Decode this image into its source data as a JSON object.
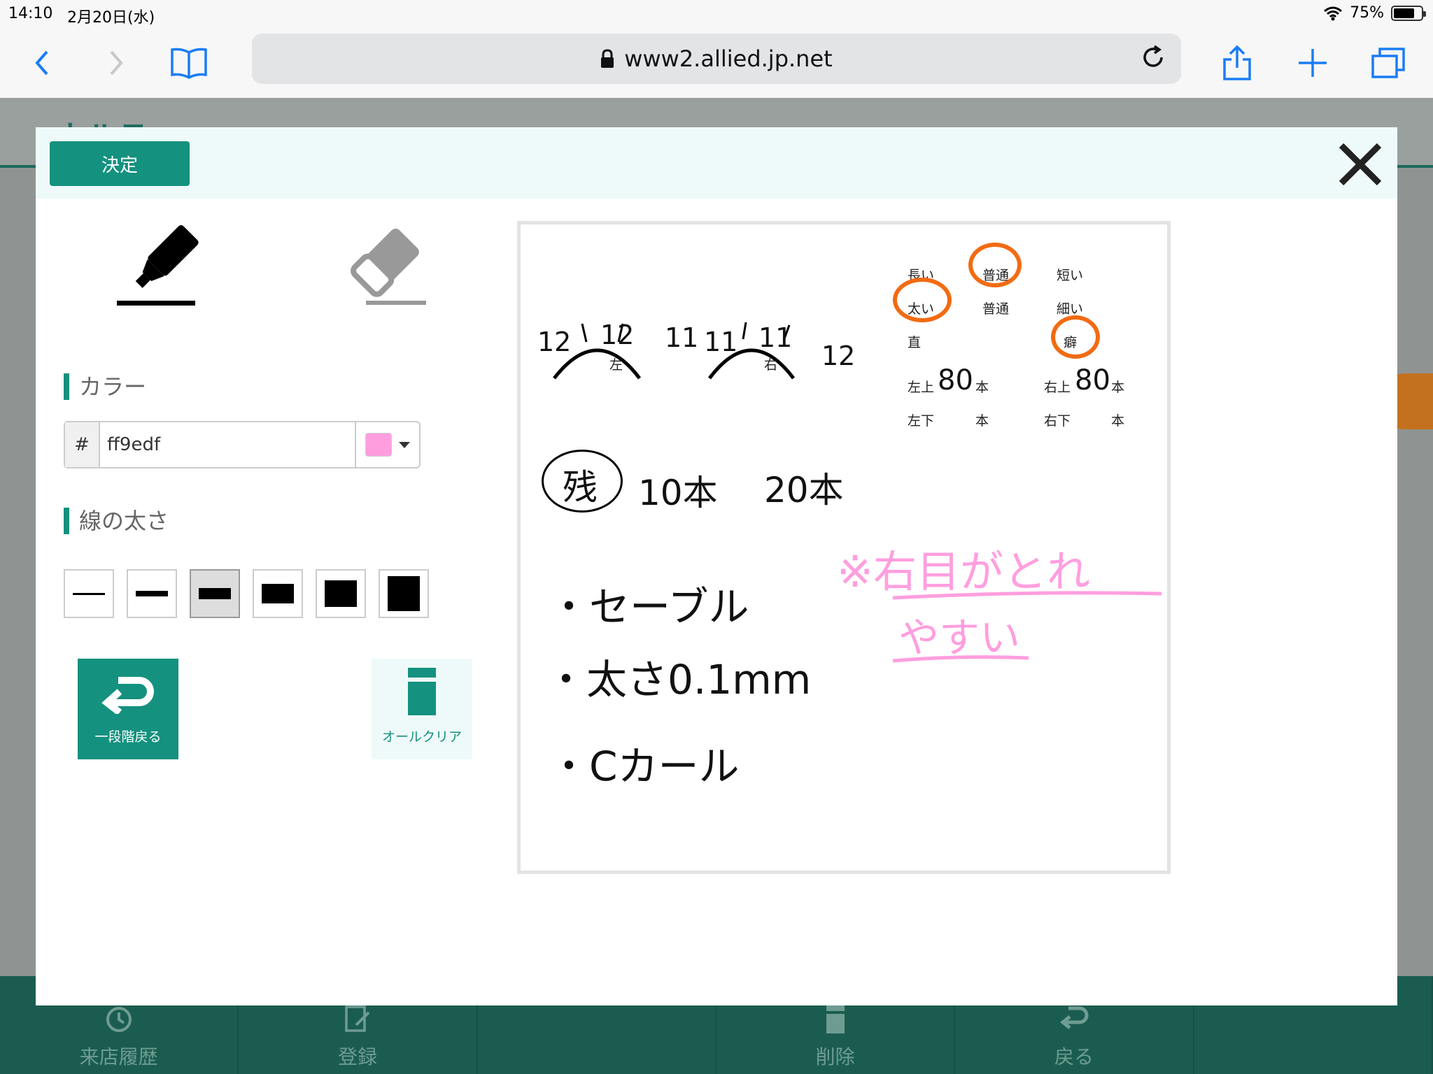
{
  "status": {
    "time": "14:10",
    "date": "2月20日(水)",
    "battery": "75%",
    "battery_level": 0.75
  },
  "browser": {
    "url": "www2.allied.jp.net"
  },
  "underlying": {
    "title": "カルテ",
    "bottom_tabs": [
      "来店履歴",
      "登録",
      "",
      "削除",
      "戻る",
      ""
    ]
  },
  "modal": {
    "decide_label": "決定",
    "color_label": "カラー",
    "color_hash": "#",
    "color_value": "ff9edf",
    "swatch_color": "#ff9edf",
    "width_label": "線の太さ",
    "undo_label": "一段階戻る",
    "clear_label": "オールクリア"
  },
  "canvas": {
    "labels": {
      "long": "長い",
      "normal1": "普通",
      "short": "短い",
      "thick": "太い",
      "normal2": "普通",
      "thin": "細い",
      "straight": "直",
      "habit": "癖",
      "upper_left": "左上",
      "upper_right": "右上",
      "lower_left": "左下",
      "lower_right": "右下",
      "hon": "本",
      "left_eye": "左",
      "right_eye": "右"
    },
    "handwriting": {
      "counts_left": [
        "12",
        "12",
        "11"
      ],
      "counts_right": [
        "11",
        "11",
        "12"
      ],
      "upper_left_count": "80",
      "upper_right_count": "80",
      "zan": "残",
      "zan_a": "10本",
      "zan_b": "20本",
      "note1": "・セーブル",
      "note2": "・太さ0.1mm",
      "note3": "・Cカール",
      "pink_line1": "※右目がとれ",
      "pink_line2": "やすい"
    }
  }
}
